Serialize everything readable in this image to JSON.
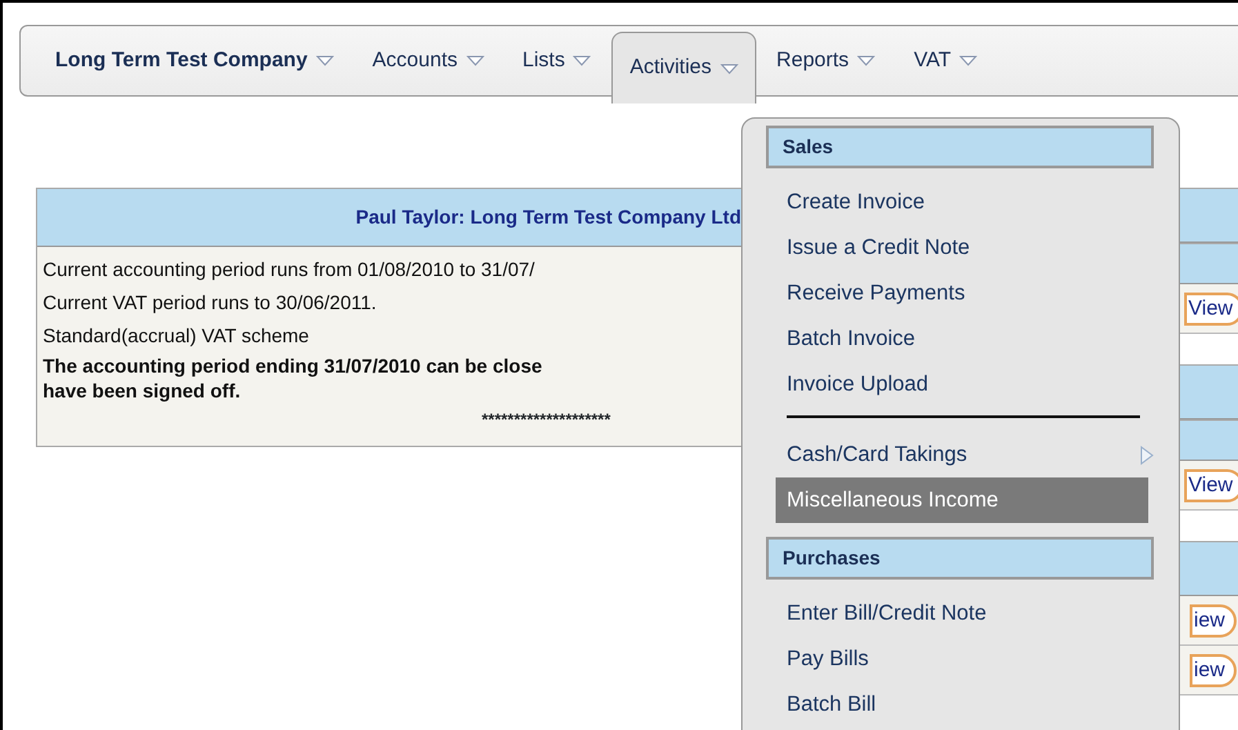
{
  "navbar": {
    "menus": [
      {
        "label": "Long Term Test Company",
        "kind": "brand",
        "selected": false
      },
      {
        "label": "Accounts",
        "kind": "menu",
        "selected": false
      },
      {
        "label": "Lists",
        "kind": "menu",
        "selected": false
      },
      {
        "label": "Activities",
        "kind": "menu",
        "selected": true
      },
      {
        "label": "Reports",
        "kind": "menu",
        "selected": false
      },
      {
        "label": "VAT",
        "kind": "menu",
        "selected": false
      }
    ]
  },
  "summary_panel": {
    "title": "Paul Taylor: Long Term Test Company Ltd",
    "lines": [
      {
        "text": "Current accounting period runs from 01/08/2010 to 31/07/",
        "bold": false
      },
      {
        "text": "Current VAT period runs to 30/06/2011.",
        "bold": false
      },
      {
        "text": "Standard(accrual) VAT scheme",
        "bold": false
      },
      {
        "text": "The accounting period ending 31/07/2010 can be close",
        "bold": true
      },
      {
        "text": "have been signed off.",
        "bold": true
      }
    ],
    "footer": "********************"
  },
  "side_panels": [
    {
      "view_buttons": [
        "View"
      ]
    },
    {
      "view_buttons": [
        "View"
      ]
    },
    {
      "view_buttons": [
        "iew",
        "iew"
      ]
    }
  ],
  "dropdown": {
    "sections": [
      {
        "heading": "Sales",
        "items": [
          {
            "kind": "item",
            "label": "Create Invoice",
            "selected": false
          },
          {
            "kind": "item",
            "label": "Issue a Credit Note",
            "selected": false
          },
          {
            "kind": "item",
            "label": "Receive Payments",
            "selected": false
          },
          {
            "kind": "item",
            "label": "Batch Invoice",
            "selected": false
          },
          {
            "kind": "item",
            "label": "Invoice Upload",
            "selected": false
          },
          {
            "kind": "divider"
          },
          {
            "kind": "submenu",
            "label": "Cash/Card Takings",
            "selected": false
          },
          {
            "kind": "item",
            "label": "Miscellaneous Income",
            "selected": true
          }
        ]
      },
      {
        "heading": "Purchases",
        "items": [
          {
            "kind": "item",
            "label": "Enter Bill/Credit Note",
            "selected": false
          },
          {
            "kind": "item",
            "label": "Pay Bills",
            "selected": false
          },
          {
            "kind": "item",
            "label": "Batch Bill",
            "selected": false
          }
        ]
      }
    ]
  }
}
